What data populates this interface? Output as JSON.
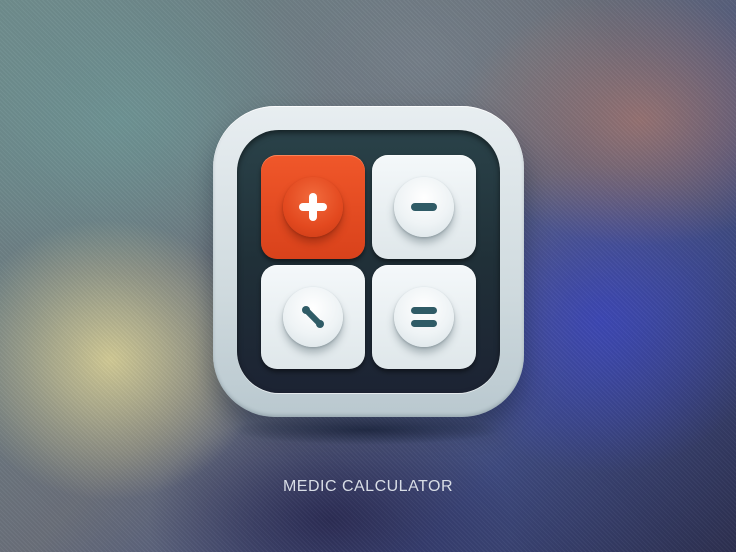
{
  "app": {
    "caption": "MEDIC CALCULATOR"
  },
  "keys": [
    {
      "id": "plus",
      "icon": "plus-icon",
      "style": "accent",
      "color": "#e44a1f"
    },
    {
      "id": "minus",
      "icon": "minus-icon",
      "style": "light",
      "color": "#2f5b66"
    },
    {
      "id": "percent",
      "icon": "percent-icon",
      "style": "light",
      "color": "#2f5b66"
    },
    {
      "id": "equals",
      "icon": "equals-icon",
      "style": "light",
      "color": "#2f5b66"
    }
  ]
}
